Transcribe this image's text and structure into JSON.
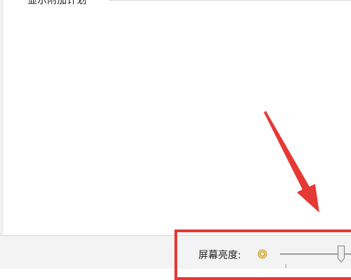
{
  "section": {
    "title": "显示附加计划"
  },
  "brightness": {
    "label": "屏幕亮度:",
    "value_fraction": 0.88
  },
  "colors": {
    "highlight": "#e53935",
    "arrow": "#e53935",
    "sun_icon": "#c89a2c"
  },
  "icons": {
    "sun": "sun-icon",
    "slider_thumb": "slider-thumb"
  }
}
